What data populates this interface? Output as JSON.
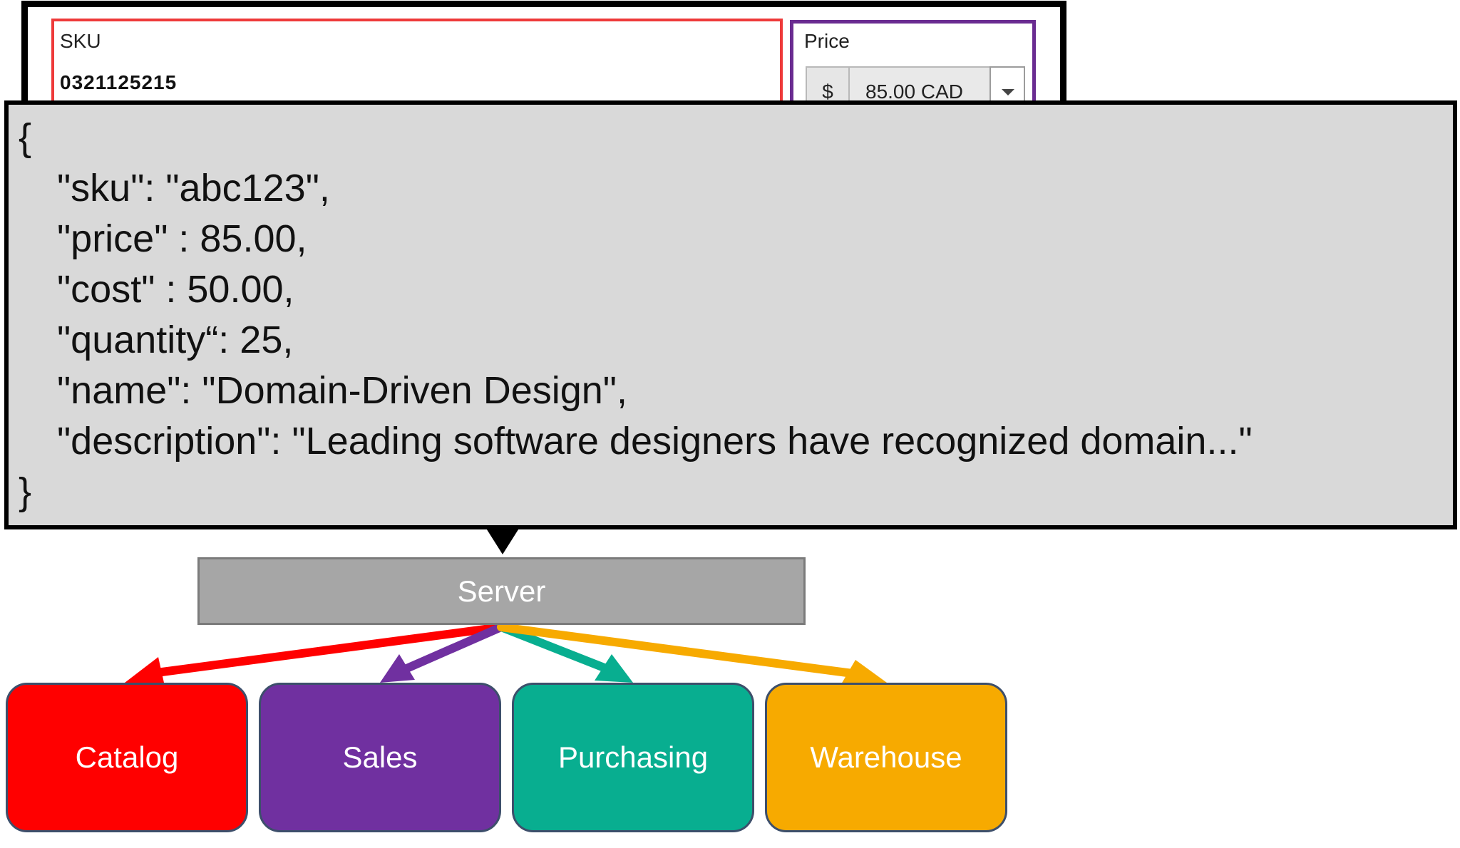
{
  "form": {
    "sku_label": "SKU",
    "sku_value": "0321125215",
    "price_label": "Price",
    "currency_symbol": "$",
    "price_value": "85.00 CAD",
    "sku_border_color": "#ee3a3a",
    "price_border_color": "#6a2c91"
  },
  "json_callout": {
    "lines": [
      "{",
      "\"sku\": \"abc123\",",
      "\"price\" : 85.00,",
      "\"cost\" : 50.00,",
      "\"quantity“: 25,",
      "\"name\": \"Domain-Driven Design\",",
      "\"description\": \"Leading software designers have recognized domain...\"",
      "}"
    ]
  },
  "server": {
    "label": "Server"
  },
  "domains": [
    {
      "label": "Catalog",
      "color": "#ff0000"
    },
    {
      "label": "Sales",
      "color": "#7030a0"
    },
    {
      "label": "Purchasing",
      "color": "#08ae90"
    },
    {
      "label": "Warehouse",
      "color": "#f7aa00"
    }
  ]
}
